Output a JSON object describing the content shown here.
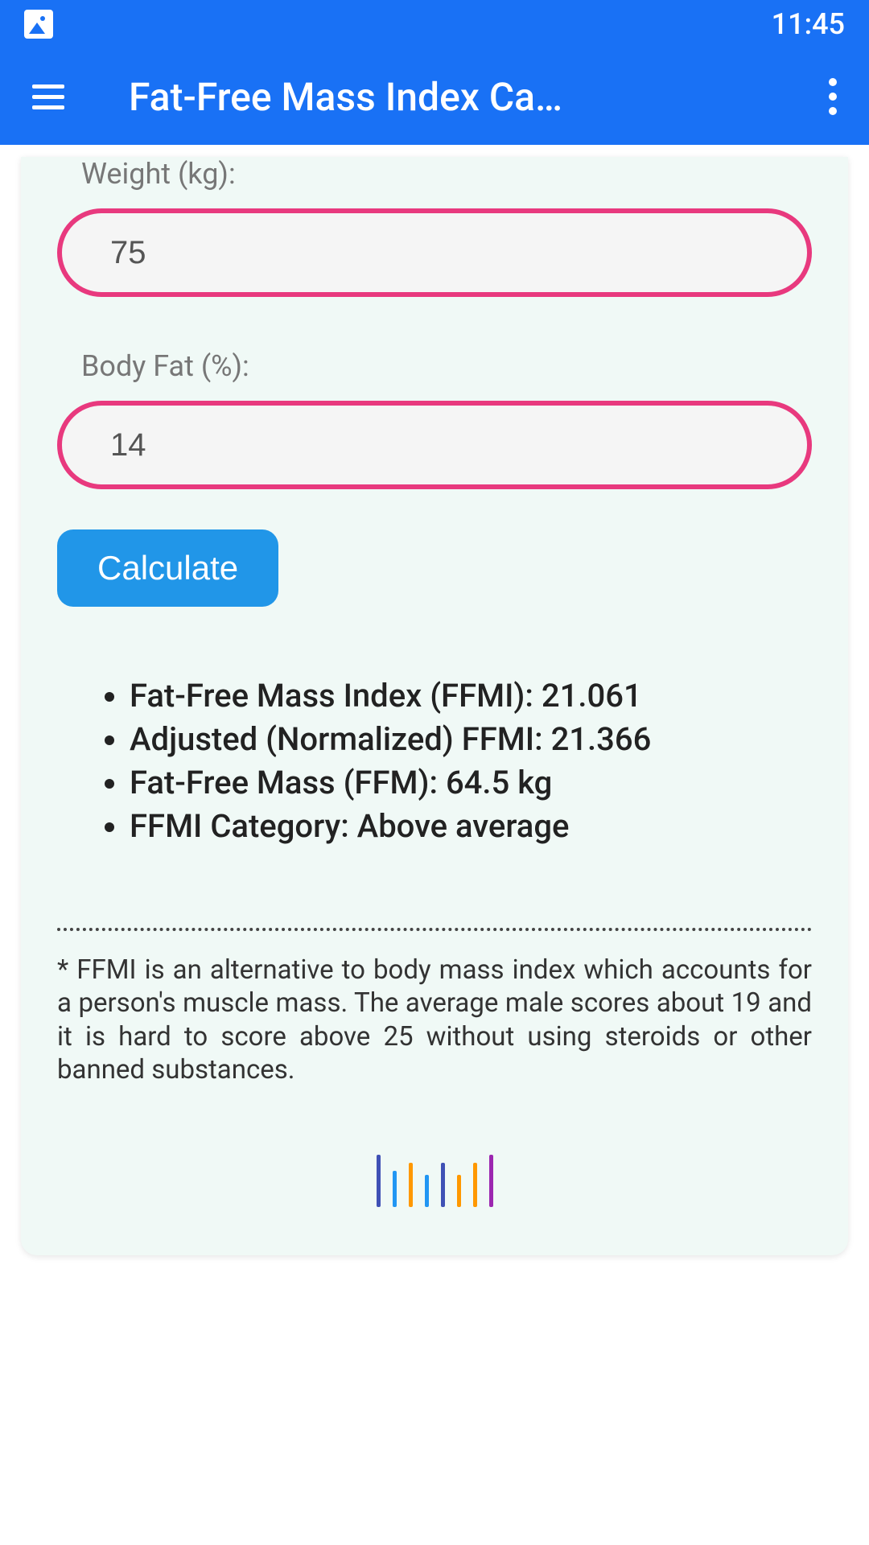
{
  "status": {
    "time": "11:45"
  },
  "header": {
    "title": "Fat-Free Mass Index Ca…"
  },
  "form": {
    "weight_label": "Weight (kg):",
    "weight_value": "75",
    "bodyfat_label": "Body Fat (%):",
    "bodyfat_value": "14",
    "calculate_label": "Calculate"
  },
  "results": {
    "ffmi": "Fat-Free Mass Index (FFMI): 21.061",
    "adjusted": "Adjusted (Normalized) FFMI: 21.366",
    "ffm": "Fat-Free Mass (FFM): 64.5 kg",
    "category": "FFMI Category: Above average"
  },
  "info": {
    "text": "* FFMI is an alternative to body mass index which accounts for a person's muscle mass. The average male scores about 19 and it is hard to score above 25 without using steroids or other banned substances."
  }
}
